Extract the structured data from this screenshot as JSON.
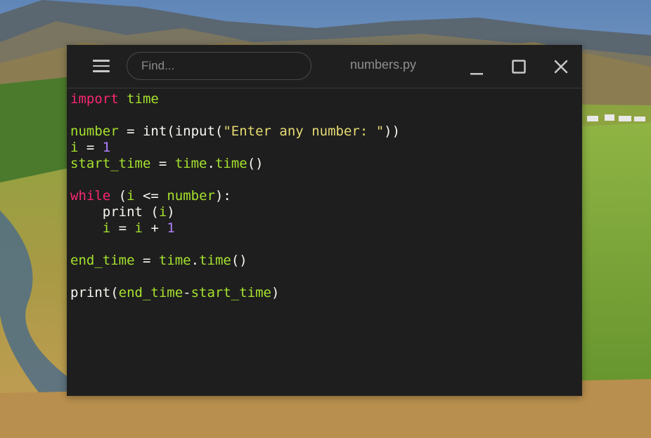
{
  "window": {
    "title": "numbers.py",
    "search_placeholder": "Find...",
    "menu_icon": "hamburger-icon",
    "controls": [
      "minimize-icon",
      "maximize-icon",
      "close-icon"
    ]
  },
  "colors": {
    "editor_bg": "#1e1e1e",
    "keyword": "#f92672",
    "identifier": "#a6e22e",
    "string": "#e6db74",
    "number": "#ae81ff",
    "plain": "#f8f8f2"
  },
  "code": {
    "lines": [
      [
        {
          "t": "import",
          "c": "kw"
        },
        {
          "t": " ",
          "c": "op"
        },
        {
          "t": "time",
          "c": "id"
        }
      ],
      [],
      [
        {
          "t": "number",
          "c": "id"
        },
        {
          "t": " = ",
          "c": "op"
        },
        {
          "t": "int(input(",
          "c": "fn"
        },
        {
          "t": "\"Enter any number: \"",
          "c": "str"
        },
        {
          "t": "))",
          "c": "fn"
        }
      ],
      [
        {
          "t": "i",
          "c": "id"
        },
        {
          "t": " = ",
          "c": "op"
        },
        {
          "t": "1",
          "c": "num"
        }
      ],
      [
        {
          "t": "start_time",
          "c": "id"
        },
        {
          "t": " = ",
          "c": "op"
        },
        {
          "t": "time",
          "c": "id"
        },
        {
          "t": ".",
          "c": "op"
        },
        {
          "t": "time",
          "c": "id"
        },
        {
          "t": "()",
          "c": "fn"
        }
      ],
      [],
      [
        {
          "t": "while",
          "c": "kw"
        },
        {
          "t": " (",
          "c": "op"
        },
        {
          "t": "i",
          "c": "id"
        },
        {
          "t": " <= ",
          "c": "op"
        },
        {
          "t": "number",
          "c": "id"
        },
        {
          "t": "):",
          "c": "op"
        }
      ],
      [
        {
          "t": "    print (",
          "c": "fn"
        },
        {
          "t": "i",
          "c": "id"
        },
        {
          "t": ")",
          "c": "fn"
        }
      ],
      [
        {
          "t": "    ",
          "c": "op"
        },
        {
          "t": "i",
          "c": "id"
        },
        {
          "t": " = ",
          "c": "op"
        },
        {
          "t": "i",
          "c": "id"
        },
        {
          "t": " + ",
          "c": "op"
        },
        {
          "t": "1",
          "c": "num"
        }
      ],
      [],
      [
        {
          "t": "end_time",
          "c": "id"
        },
        {
          "t": " = ",
          "c": "op"
        },
        {
          "t": "time",
          "c": "id"
        },
        {
          "t": ".",
          "c": "op"
        },
        {
          "t": "time",
          "c": "id"
        },
        {
          "t": "()",
          "c": "fn"
        }
      ],
      [],
      [
        {
          "t": "print(",
          "c": "fn"
        },
        {
          "t": "end_time",
          "c": "id"
        },
        {
          "t": "-",
          "c": "op"
        },
        {
          "t": "start_time",
          "c": "id"
        },
        {
          "t": ")",
          "c": "fn"
        }
      ]
    ]
  }
}
